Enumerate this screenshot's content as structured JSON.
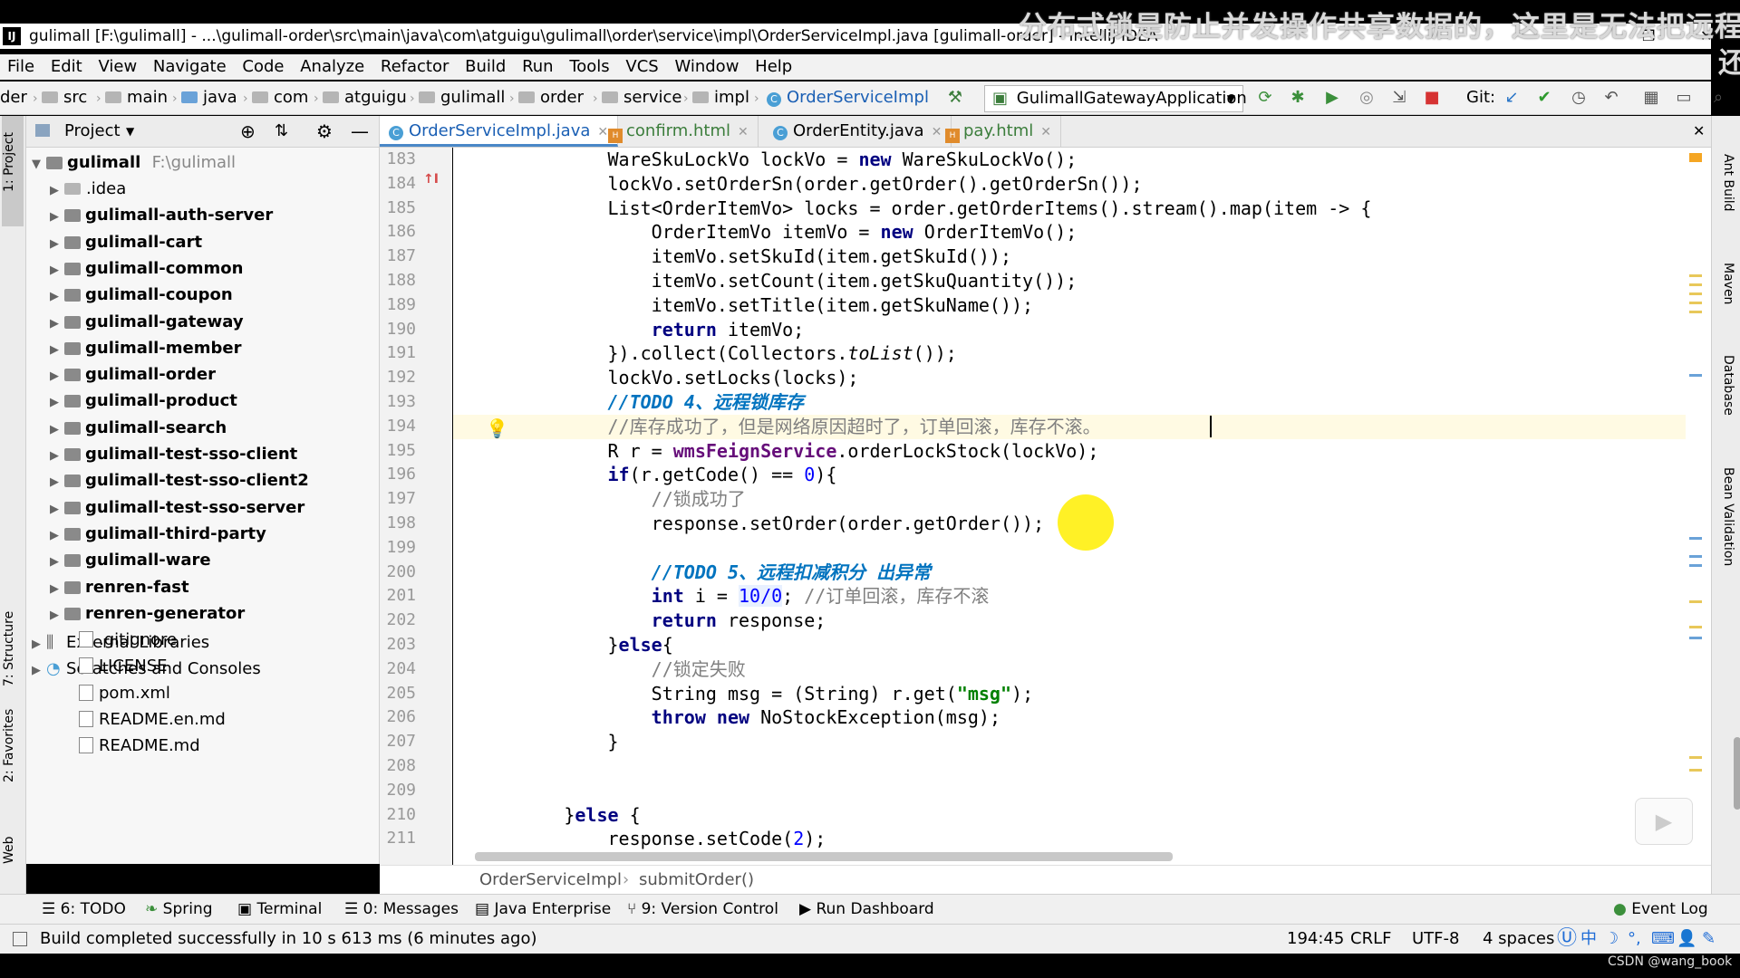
{
  "window": {
    "title": "gulimall [F:\\gulimall] - ...\\gulimall-order\\src\\main\\java\\com\\atguigu\\gulimall\\order\\service\\impl\\OrderServiceImpl.java [gulimall-order] - IntelliJ IDEA",
    "logo": "IJ",
    "overlay_text": "分布式锁是防止并发操作共享数据的，这里是无法把远程",
    "overlay_text2": "还"
  },
  "menu": [
    "File",
    "Edit",
    "View",
    "Navigate",
    "Code",
    "Analyze",
    "Refactor",
    "Build",
    "Run",
    "Tools",
    "VCS",
    "Window",
    "Help"
  ],
  "nav": {
    "crumbs": [
      "der",
      "src",
      "main",
      "java",
      "com",
      "atguigu",
      "gulimall",
      "order",
      "service",
      "impl",
      "OrderServiceImpl"
    ],
    "run_config": "GulimallGatewayApplication",
    "git_label": "Git:"
  },
  "left_strip": {
    "project": "1: Project",
    "structure": "7: Structure",
    "favorites": "2: Favorites",
    "web": "Web"
  },
  "right_strip": {
    "ant": "Ant Build",
    "maven": "Maven",
    "database": "Database",
    "bean": "Bean Validation"
  },
  "project_panel": {
    "title": "Project",
    "root": {
      "name": "gulimall",
      "path": "F:\\gulimall"
    },
    "items": [
      {
        "label": ".idea",
        "type": "folder"
      },
      {
        "label": "gulimall-auth-server",
        "type": "module"
      },
      {
        "label": "gulimall-cart",
        "type": "module"
      },
      {
        "label": "gulimall-common",
        "type": "module"
      },
      {
        "label": "gulimall-coupon",
        "type": "module"
      },
      {
        "label": "gulimall-gateway",
        "type": "module"
      },
      {
        "label": "gulimall-member",
        "type": "module"
      },
      {
        "label": "gulimall-order",
        "type": "module"
      },
      {
        "label": "gulimall-product",
        "type": "module"
      },
      {
        "label": "gulimall-search",
        "type": "module"
      },
      {
        "label": "gulimall-test-sso-client",
        "type": "module"
      },
      {
        "label": "gulimall-test-sso-client2",
        "type": "module"
      },
      {
        "label": "gulimall-test-sso-server",
        "type": "module"
      },
      {
        "label": "gulimall-third-party",
        "type": "module"
      },
      {
        "label": "gulimall-ware",
        "type": "module"
      },
      {
        "label": "renren-fast",
        "type": "module"
      },
      {
        "label": "renren-generator",
        "type": "module"
      },
      {
        "label": ".gitignore",
        "type": "file"
      },
      {
        "label": "LICENSE",
        "type": "file"
      },
      {
        "label": "pom.xml",
        "type": "file"
      },
      {
        "label": "README.en.md",
        "type": "file"
      },
      {
        "label": "README.md",
        "type": "file"
      }
    ],
    "external_libraries": "External Libraries",
    "scratches": "Scratches and Consoles"
  },
  "tabs": [
    {
      "label": "OrderServiceImpl.java",
      "active": true
    },
    {
      "label": "confirm.html",
      "active": false
    },
    {
      "label": "OrderEntity.java",
      "active": false
    },
    {
      "label": "pay.html",
      "active": false
    }
  ],
  "editor": {
    "line_numbers": [
      "183",
      "184",
      "185",
      "186",
      "187",
      "188",
      "189",
      "190",
      "191",
      "192",
      "193",
      "194",
      "195",
      "196",
      "197",
      "198",
      "199",
      "200",
      "201",
      "202",
      "203",
      "204",
      "205",
      "206",
      "207",
      "208",
      "209",
      "210",
      "211"
    ],
    "lines": {
      "l183a": "            WareSkuLockVo lockVo = ",
      "l183b": "new",
      "l183c": " WareSkuLockVo();",
      "l184": "            lockVo.setOrderSn(order.getOrder().getOrderSn());",
      "l185": "            List<OrderItemVo> locks = order.getOrderItems().stream().map(item -> {",
      "l186a": "                OrderItemVo itemVo = ",
      "l186b": "new",
      "l186c": " OrderItemVo();",
      "l187": "                itemVo.setSkuId(item.getSkuId());",
      "l188": "                itemVo.setCount(item.getSkuQuantity());",
      "l189": "                itemVo.setTitle(item.getSkuName());",
      "l190a": "                ",
      "l190b": "return",
      "l190c": " itemVo;",
      "l191a": "            }).collect(Collectors.",
      "l191b": "toList",
      "l191c": "());",
      "l192": "            lockVo.setLocks(locks);",
      "l193a": "            //",
      "l193b": "TODO 4、远程锁库存",
      "l194a": "            ",
      "l194b": "//库存成功了，但是网络原因超时了，订单回滚，库存不滚。",
      "l195a": "            R r = ",
      "l195b": "wmsFeignService",
      "l195c": ".orderLockStock(lockVo);",
      "l196a": "            ",
      "l196b": "if",
      "l196c": "(r.getCode() == ",
      "l196d": "0",
      "l196e": "){",
      "l197a": "                ",
      "l197b": "//锁成功了",
      "l198": "                response.setOrder(order.getOrder());",
      "l199": "",
      "l200a": "                //",
      "l200b": "TODO 5、远程扣减积分 出异常",
      "l201a": "                ",
      "l201b": "int",
      "l201c": " i = ",
      "l201d": "10/0",
      "l201e": "; ",
      "l201f": "//订单回滚，库存不滚",
      "l202a": "                ",
      "l202b": "return",
      "l202c": " response;",
      "l203a": "            }",
      "l203b": "else",
      "l203c": "{",
      "l204a": "                ",
      "l204b": "//锁定失败",
      "l205a": "                String msg = (String) r.get(",
      "l205b": "\"msg\"",
      "l205c": ");",
      "l206a": "                ",
      "l206b": "throw",
      "l206c": " ",
      "l206d": "new",
      "l206e": " NoStockException(msg);",
      "l207": "            }",
      "l208": "",
      "l209": "",
      "l210a": "        }",
      "l210b": "else",
      "l210c": " {",
      "l211a": "            response.setCode(",
      "l211b": "2",
      "l211c": ");"
    }
  },
  "breadcrumb": {
    "cls": "OrderServiceImpl",
    "method": "submitOrder()"
  },
  "toolwindows": [
    "6: TODO",
    "Spring",
    "Terminal",
    "0: Messages",
    "Java Enterprise",
    "9: Version Control",
    "Run Dashboard",
    "Event Log"
  ],
  "status": {
    "message": "Build completed successfully in 10 s 613 ms (6 minutes ago)",
    "position": "194:45",
    "line_sep": "CRLF",
    "encoding": "UTF-8",
    "indent": "4 spaces",
    "ime": "中"
  },
  "watermark": "CSDN @wang_book",
  "colors": {
    "keyword": "#000080",
    "comment": "#808080",
    "todo": "#0073bf",
    "number": "#0000ff",
    "string": "#008000",
    "field": "#660e7a",
    "accent": "#4a88c7"
  }
}
